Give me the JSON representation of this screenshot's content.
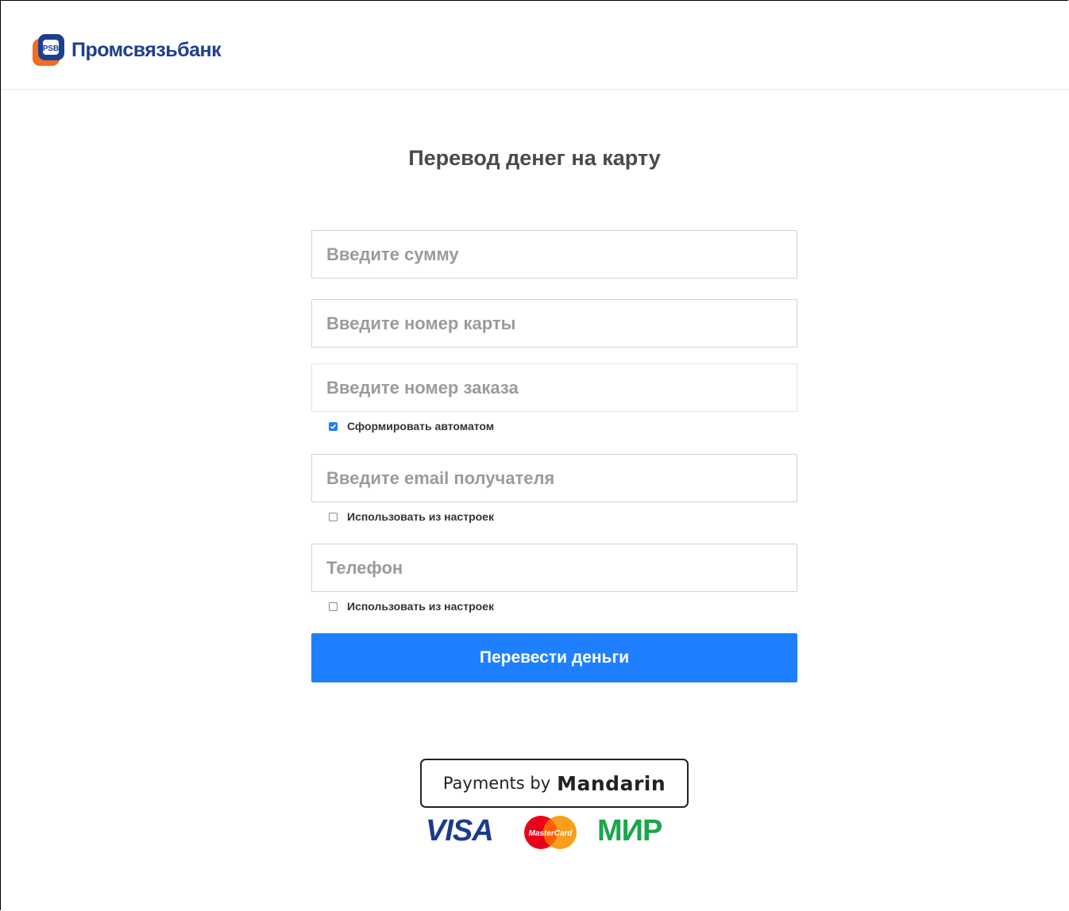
{
  "header": {
    "brand_name": "Промсвязьбанк",
    "logo_colors": {
      "orange": "#f26c22",
      "blue": "#1d3f8f"
    }
  },
  "page": {
    "title": "Перевод денег на карту"
  },
  "form": {
    "amount": {
      "value": "",
      "placeholder": "Введите сумму"
    },
    "card_number": {
      "value": "",
      "placeholder": "Введите номер карты"
    },
    "order_number": {
      "value": "",
      "placeholder": "Введите номер заказа"
    },
    "auto_generate": {
      "label": "Сформировать автоматом",
      "checked": true
    },
    "email": {
      "value": "",
      "placeholder": "Введите email получателя"
    },
    "email_use_settings": {
      "label": "Использовать из настроек",
      "checked": false
    },
    "phone": {
      "value": "",
      "placeholder": "Телефон"
    },
    "phone_use_settings": {
      "label": "Использовать из настроек",
      "checked": false
    },
    "submit_label": "Перевести деньги"
  },
  "footer": {
    "payments_prefix": "Payments by",
    "payments_brand": "Mandarin",
    "visa_label": "VISA",
    "mastercard_label": "MasterCard",
    "mir_label": "МИР"
  },
  "colors": {
    "primary_button": "#1f80ff",
    "checkbox_checked": "#1f7ff2",
    "visa": "#1b3b8d",
    "mir": "#1aa64a"
  }
}
